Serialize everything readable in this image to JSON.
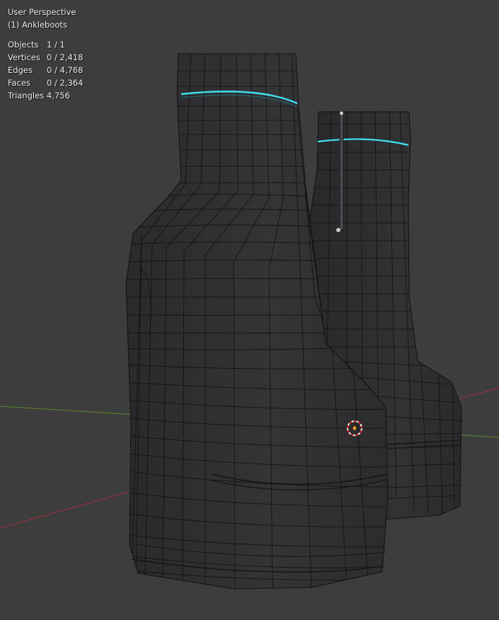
{
  "viewport": {
    "view_name": "User Perspective",
    "object_name": "(1) Ankleboots",
    "stats": [
      {
        "label": "Objects",
        "value": "1 / 1"
      },
      {
        "label": "Vertices",
        "value": "0 / 2,418"
      },
      {
        "label": "Edges",
        "value": "0 / 4,768"
      },
      {
        "label": "Faces",
        "value": "0 / 2,364"
      },
      {
        "label": "Triangles",
        "value": "4,756"
      }
    ]
  },
  "colors": {
    "background": "#3d3d3d",
    "mesh": "#2f2f31",
    "wire": "#0f0f10",
    "seam": "#3fe0f0",
    "x_axis": "#a03040",
    "y_axis": "#5a8a2a"
  },
  "icons": [
    "3d-cursor-icon"
  ]
}
